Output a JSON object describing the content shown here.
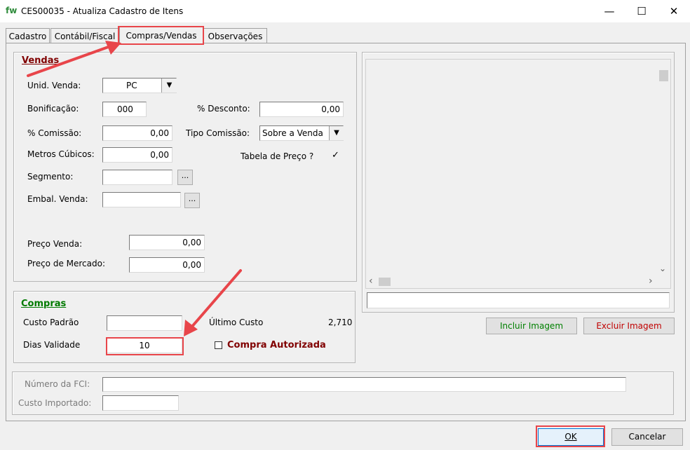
{
  "window": {
    "logo": "fw",
    "title": "CES00035 - Atualiza Cadastro de Itens",
    "minimize": "—",
    "maximize": "☐",
    "close": "✕"
  },
  "tabs": [
    {
      "label": "Cadastro"
    },
    {
      "label": "Contábil/Fiscal"
    },
    {
      "label": "Compras/Vendas"
    },
    {
      "label": "Observações"
    }
  ],
  "vendas": {
    "title": "Vendas",
    "unid_venda_label": "Unid. Venda:",
    "unid_venda_value": "PC",
    "bonificacao_label": "Bonificação:",
    "bonificacao_value": "000",
    "desconto_label": "% Desconto:",
    "desconto_value": "0,00",
    "comissao_label": "% Comissão:",
    "comissao_value": "0,00",
    "tipo_comissao_label": "Tipo Comissão:",
    "tipo_comissao_value": "Sobre a Venda",
    "metros_label": "Metros Cúbicos:",
    "metros_value": "0,00",
    "tabela_preco_label": "Tabela de Preço ?",
    "tabela_preco_checked": "✓",
    "segmento_label": "Segmento:",
    "segmento_value": "",
    "embal_label": "Embal. Venda:",
    "embal_value": "",
    "dots": "...",
    "preco_venda_label": "Preço Venda:",
    "preco_venda_value": "0,00",
    "preco_mercado_label": "Preço de Mercado:",
    "preco_mercado_value": "0,00"
  },
  "compras": {
    "title": "Compras",
    "custo_padrao_label": "Custo Padrão",
    "custo_padrao_value": "",
    "ultimo_custo_label": "Último Custo",
    "ultimo_custo_value": "2,710",
    "dias_validade_label": "Dias Validade",
    "dias_validade_value": "10",
    "compra_autorizada_label": "Compra Autorizada"
  },
  "image_panel": {
    "scroll_up": "▲",
    "scroll_down": "⌄",
    "scroll_left": "‹",
    "scroll_right": "›",
    "path_value": "",
    "incluir_label": "Incluir Imagem",
    "excluir_label": "Excluir Imagem"
  },
  "fci": {
    "numero_label": "Número da FCI:",
    "numero_value": "",
    "custo_importado_label": "Custo Importado:",
    "custo_importado_value": ""
  },
  "footer": {
    "ok_label": "OK",
    "cancelar_label": "Cancelar"
  },
  "colors": {
    "vendas_title": "#800000",
    "compras_title": "#007a00",
    "incluir_text": "#008000",
    "excluir_text": "#c00000",
    "annotation_red": "#e8454a"
  }
}
